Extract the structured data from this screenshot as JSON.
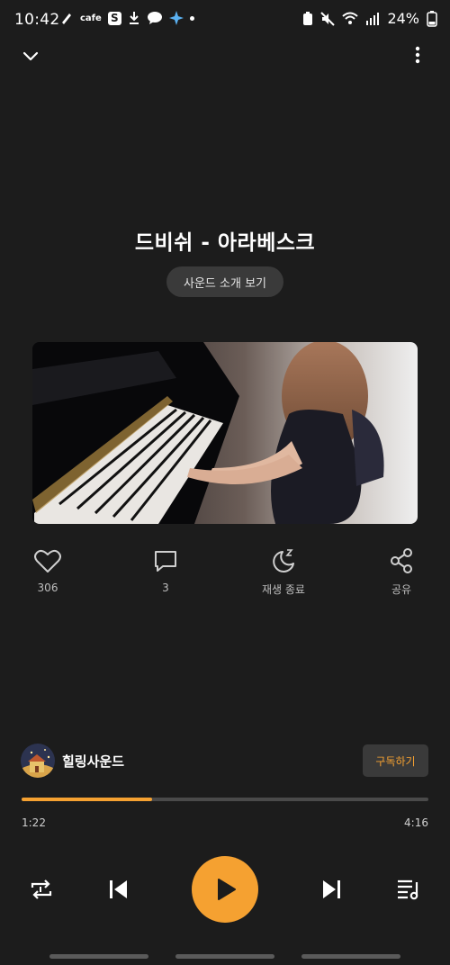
{
  "status_bar": {
    "time": "10:42",
    "cafe_label": "cafe",
    "s_label": "S",
    "battery": "24%"
  },
  "track": {
    "title": "드비쉬 - 아라베스크",
    "intro_button": "사운드 소개 보기"
  },
  "actions": {
    "like_count": "306",
    "comment_count": "3",
    "sleep_label": "재생 종료",
    "share_label": "공유"
  },
  "channel": {
    "name": "힐링사운드",
    "subscribe_label": "구독하기"
  },
  "player": {
    "current_time": "1:22",
    "total_time": "4:16",
    "progress_fraction": 0.32
  },
  "colors": {
    "accent": "#f5a131",
    "background": "#1c1c1c"
  },
  "icons": {
    "collapse": "chevron-down-icon",
    "more": "more-vertical-icon",
    "like": "heart-icon",
    "comment": "comment-icon",
    "sleep": "moon-sleep-icon",
    "share": "share-icon",
    "repeat": "repeat-icon",
    "previous": "skip-previous-icon",
    "play": "play-icon",
    "next": "skip-next-icon",
    "playlist": "playlist-icon"
  }
}
